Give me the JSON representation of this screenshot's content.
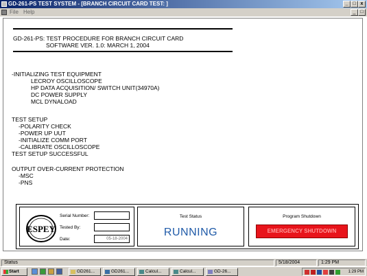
{
  "window": {
    "title": "GD-261-PS TEST SYSTEM - [BRANCH CIRCUIT CARD TEST: ]",
    "controls": [
      "_",
      "□",
      "x"
    ]
  },
  "menu": {
    "file": "File",
    "help": "Help"
  },
  "doc": {
    "header1": "GD-261-PS: TEST PROCEDURE FOR BRANCH CIRCUIT CARD",
    "header2": "SOFTWARE VER. 1.0: MARCH 1, 2004",
    "init_title": "-INITIALIZING TEST EQUIPMENT",
    "equipment": [
      "LECROY OSCILLOSCOPE",
      "HP DATA ACQUISITION/ SWITCH UNIT(34970A)",
      "DC POWER SUPPLY",
      "MCL DYNALOAD"
    ],
    "setup_title": "TEST SETUP",
    "setup_steps": [
      "-POLARITY CHECK",
      "-POWER UP UUT",
      "-INITIALIZE COMM PORT",
      "-CALIBRATE OSCILLOSCOPE"
    ],
    "setup_done": "TEST SETUP SUCCESSFUL",
    "ocp_title": "OUTPUT OVER-CURRENT PROTECTION",
    "ocp_items": [
      "-MSC",
      "-PNS"
    ]
  },
  "info_panel": {
    "logo_text": "ESPEY",
    "serial_label": "Serial Number:",
    "serial_value": "",
    "tested_label": "Tested By:",
    "tested_value": "",
    "date_label": "Date:",
    "date_value": "05-18-2004"
  },
  "status_panel": {
    "title": "Test Status",
    "value": "RUNNING"
  },
  "shutdown_panel": {
    "title": "Program Shutdown",
    "button": "EMERGENCY SHUTDOWN"
  },
  "statusbar": {
    "label": "Status",
    "date": "5/18/2004",
    "time": "1:29 PM"
  },
  "taskbar": {
    "start": "Start",
    "tasks": [
      "GD261...",
      "GD261...",
      "Calcul...",
      "Calcul...",
      "GD-26..."
    ],
    "clock": "1:29 PM"
  },
  "colors": {
    "running": "#1f5aa8",
    "emergency": "#e8141b",
    "titlebar": "#0a246a"
  }
}
